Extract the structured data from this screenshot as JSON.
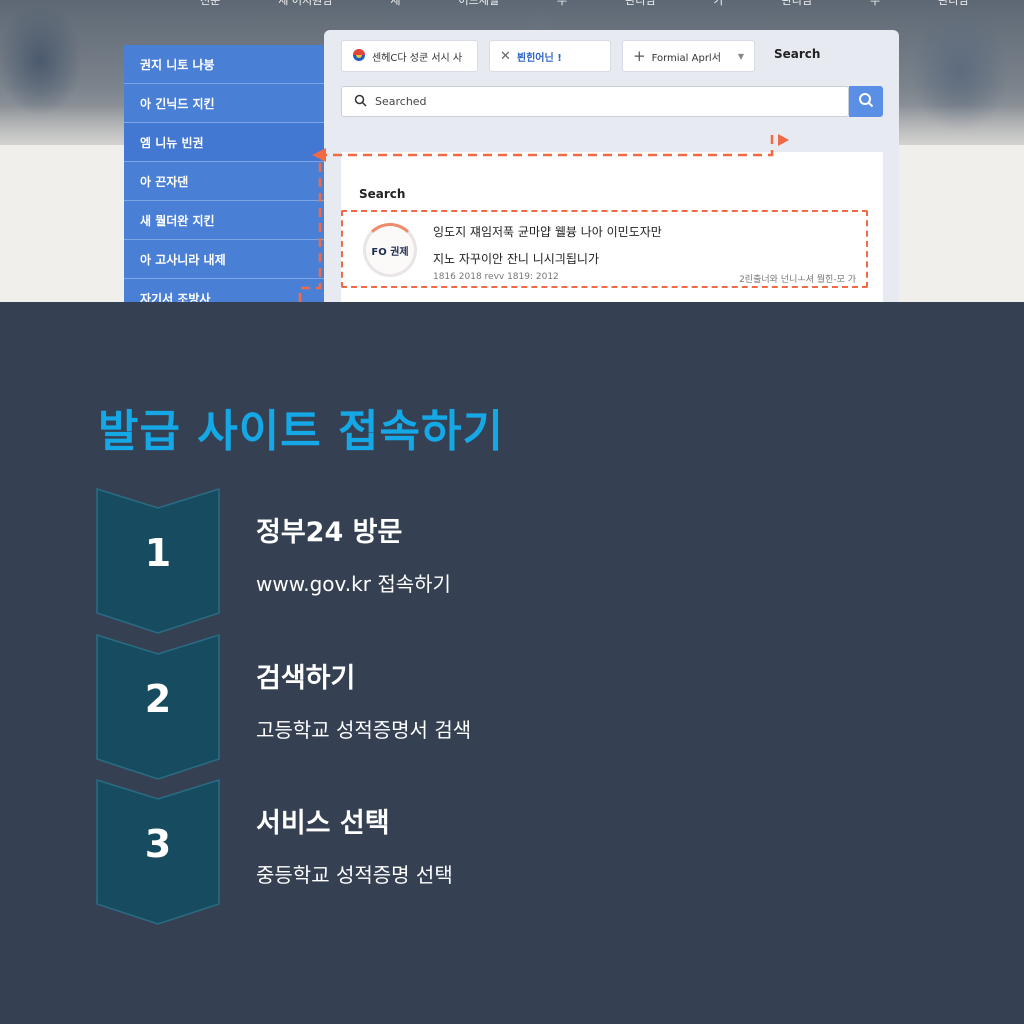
{
  "topnav": [
    "전문",
    "세 어지원님",
    "세",
    "어드세일",
    "수",
    "관리님",
    "가",
    "관리님",
    "수",
    "관리님"
  ],
  "sidebar": {
    "items": [
      {
        "label": "권지 니토 나붕"
      },
      {
        "label": "아 긴닉드 지킨"
      },
      {
        "label": "엠 니뉴 빈권"
      },
      {
        "label": "아 끈자댄"
      },
      {
        "label": "새 뭘더완 지킨"
      },
      {
        "label": "아 고사니라 내제"
      },
      {
        "label": "자기서 조방사"
      }
    ]
  },
  "browser": {
    "tabs": [
      {
        "label": "센헤C다 성쿤 서시 사"
      },
      {
        "label": "뵌힌어닌 !"
      },
      {
        "label": "Formial Aprl서"
      }
    ],
    "tab_search_label": "Search",
    "search_value": "Searched",
    "content_label": "Search",
    "result": {
      "badge": "FO 권제",
      "line1": "잉도지 쟤임저푹 균마얍 웰븅 나아 이민도자만",
      "line2": "지노 자꾸이안 잔니 니시긔됩니가",
      "meta_left": "1816 2018 revv 1819: 2012",
      "meta_right": "2린출너와 넌니ㅗ셔 뭘힌-모 가"
    }
  },
  "guide": {
    "title": "발급 사이트 접속하기",
    "steps": [
      {
        "num": "1",
        "head": "정부24 방문",
        "sub": "www.gov.kr 접속하기"
      },
      {
        "num": "2",
        "head": "검색하기",
        "sub": "고등학교 성적증명서 검색"
      },
      {
        "num": "3",
        "head": "서비스 선택",
        "sub": "중등학교 성적증명 선택"
      }
    ]
  },
  "colors": {
    "background": "#354052",
    "accent": "#14a9e6",
    "step_fill": "#174b5f",
    "sidebar": "#4a7fd6",
    "highlight": "#ef6a45"
  }
}
